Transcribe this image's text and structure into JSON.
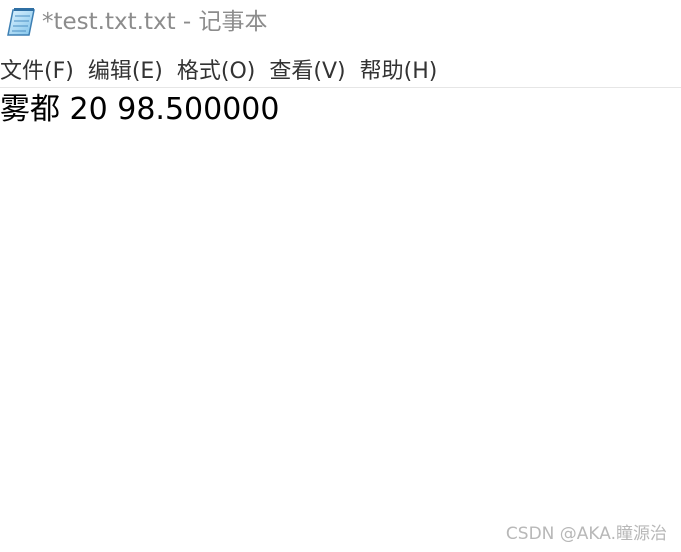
{
  "window": {
    "title": "*test.txt.txt - 记事本",
    "icon": "notepad-icon"
  },
  "menu": {
    "items": [
      {
        "label": "文件(F)"
      },
      {
        "label": "编辑(E)"
      },
      {
        "label": "格式(O)"
      },
      {
        "label": "查看(V)"
      },
      {
        "label": "帮助(H)"
      }
    ]
  },
  "editor": {
    "content": "雾都 20 98.500000"
  },
  "watermark": {
    "text": "CSDN @AKA.瞳源治"
  },
  "colors": {
    "title_text": "#8c8c8c",
    "menu_text": "#333333",
    "editor_text": "#000000",
    "watermark_text": "#b8b8b8"
  }
}
